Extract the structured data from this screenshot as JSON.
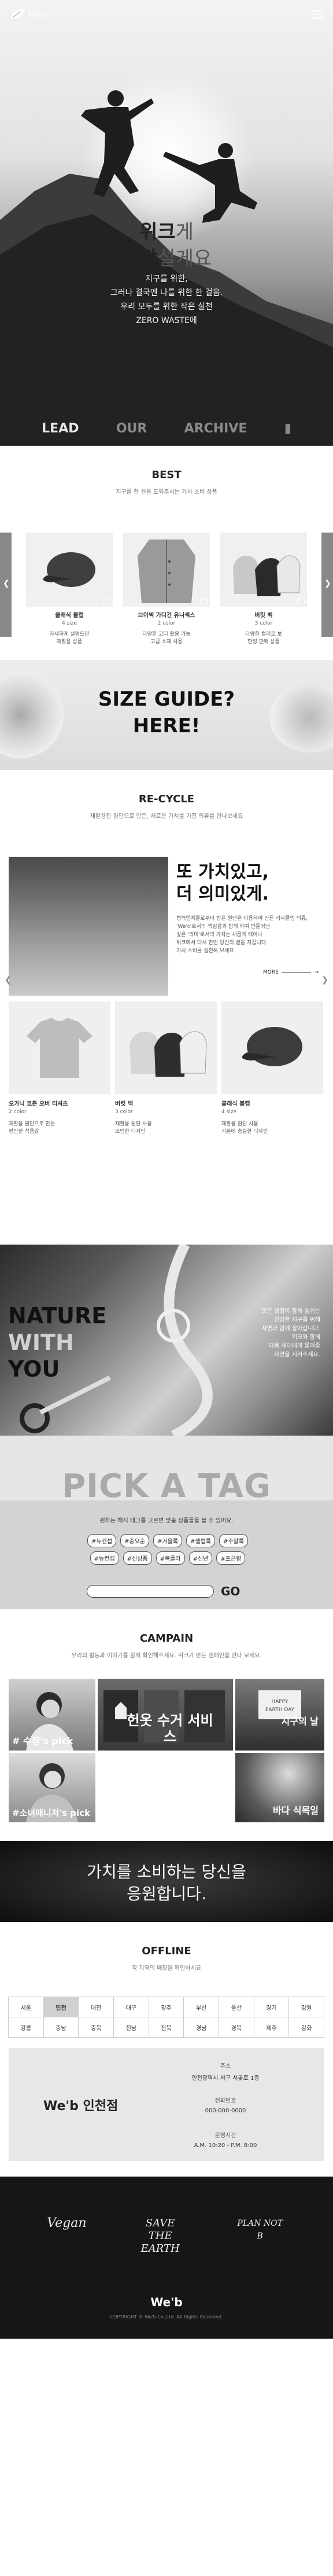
{
  "brand": {
    "logo_text": "We'c"
  },
  "hero": {
    "title_bold": "위크",
    "title_light": "게",
    "title_line2_bold": "앞장",
    "title_line2_light": "설게요",
    "subtitle": [
      "지구를 위한,",
      "그러나 결국엔 나를 위한 한 걸음.",
      "우리 모두를 위한 작은 실천",
      "ZERO WASTE에"
    ],
    "tabs": [
      "LEAD",
      "OUR",
      "ARCHIVE"
    ]
  },
  "best": {
    "title": "BEST",
    "subtitle": "지구를 한 걸음 도와주시는 가치 소비 상품",
    "items": [
      {
        "name": "클래식 볼캡",
        "option": "4 size",
        "desc": [
          "자세하게 설명드린",
          "재활용 상품"
        ]
      },
      {
        "name": "브이넥 가디건 유니섹스",
        "option": "2 color",
        "desc": [
          "다양한 코디 활용 가능",
          "고급 소재 사용"
        ]
      },
      {
        "name": "버킷 백",
        "option": "3 color",
        "desc": [
          "다양한 컬러로 보",
          "한정 판매 상품"
        ]
      }
    ]
  },
  "size_guide": {
    "line1": "SIZE GUIDE?",
    "line2": "HERE!"
  },
  "recycle": {
    "title": "RE-CYCLE",
    "subtitle": "재활용된 원단으로 만든, 새로운 가치를 가진 의류를 만나보세요",
    "headline_line1": "또 가치있고,",
    "headline_line2": "더 의미있게.",
    "desc": [
      "협력업체들로부터 받은 원단을 이용하여 만든 리사클링 의류,",
      "'We'c'로서의 책임감과 함께 하여 만들어낸",
      "깊은 '의미'로서의 가치는 새롭게 태어나",
      "위크에서 다시 한번 당신의 곁을 지킵니다.",
      "가치 소비를 실천해 보세요."
    ],
    "more_label": "MORE",
    "items": [
      {
        "name": "오가닉 코튼 오버 티셔츠",
        "option": "2 color",
        "desc": [
          "재활용 원단으로 만든",
          "편안한 착용감"
        ]
      },
      {
        "name": "버킷 백",
        "option": "3 color",
        "desc": [
          "재활용 원단 사용",
          "모던한 디자인"
        ]
      },
      {
        "name": "클래식 볼캡",
        "option": "4 size",
        "desc": [
          "재활용 원단 사용",
          "기본에 충실한 디자인"
        ]
      }
    ]
  },
  "nature": {
    "line1": "NATURE",
    "line2": "WITH",
    "line3": "YOU",
    "right_text": [
      "모든 생명이 함께 숨쉬는",
      "건강한 지구를 위해",
      "자연과 함께 살아갑니다.",
      "위크와 함께",
      "다음 세대에게 물려줄",
      "자연을 지켜주세요."
    ]
  },
  "pick_tag": {
    "title": "PICK A TAG",
    "subtitle": "원하는 해시 태그를 고르면 맞춤 상품들을 볼 수 있어요.",
    "tags_row1": [
      "#뉴컨셉",
      "#중요순",
      "#겨울룩",
      "#셀럽룩",
      "#주말룩"
    ],
    "tags_row2": [
      "#뉴컨셉",
      "#신상품",
      "#목폴라",
      "#신년",
      "#포근함"
    ],
    "input_placeholder": "",
    "go_label": "GO"
  },
  "campain": {
    "title": "CAMPAIN",
    "subtitle": "우리의 활동과 이야기를 함께 확인해주세요. 위크가 만든 캠페인을 만나 보세요.",
    "cards": [
      {
        "label": "# 수장's pick"
      },
      {
        "label": "헌옷 수거 서비스"
      },
      {
        "label": "지구의 날"
      },
      {
        "label": "#소녀매니저's pick"
      },
      {
        "label": "바다 식목일"
      }
    ]
  },
  "value_banner": {
    "line1": "가치를 소비하는 당신을",
    "line2": "응원합니다."
  },
  "offline": {
    "title": "OFFLINE",
    "subtitle": "각 지역의 매장을 확인하세요",
    "regions_row1": [
      "서울",
      "인천",
      "대전",
      "대구",
      "광주",
      "부산",
      "울산",
      "경기",
      "강원"
    ],
    "regions_row2": [
      "강릉",
      "충남",
      "충북",
      "전남",
      "전북",
      "경남",
      "경북",
      "제주",
      "강화"
    ],
    "selected": "인천",
    "store": {
      "name": "We'b 인천점",
      "address_label": "주소",
      "address_value": "인천광역시 서구 서곶로 1층",
      "phone_label": "전화번호",
      "phone_value": "000-000-0000",
      "hours_label": "운영시간",
      "hours_value": "A.M. 10:20 - P.M. 8:00"
    }
  },
  "footer": {
    "brands": [
      "Vegan",
      "SAVE THE EARTH",
      "PLAN NOT B"
    ],
    "logo": "We'b",
    "copyright": "COPYRIGHT © We'b Co.,Ltd. All Rights Reserved."
  },
  "colors": {
    "accent": "#222222",
    "band": "#d3d3d3",
    "footer_bg": "#161616"
  }
}
